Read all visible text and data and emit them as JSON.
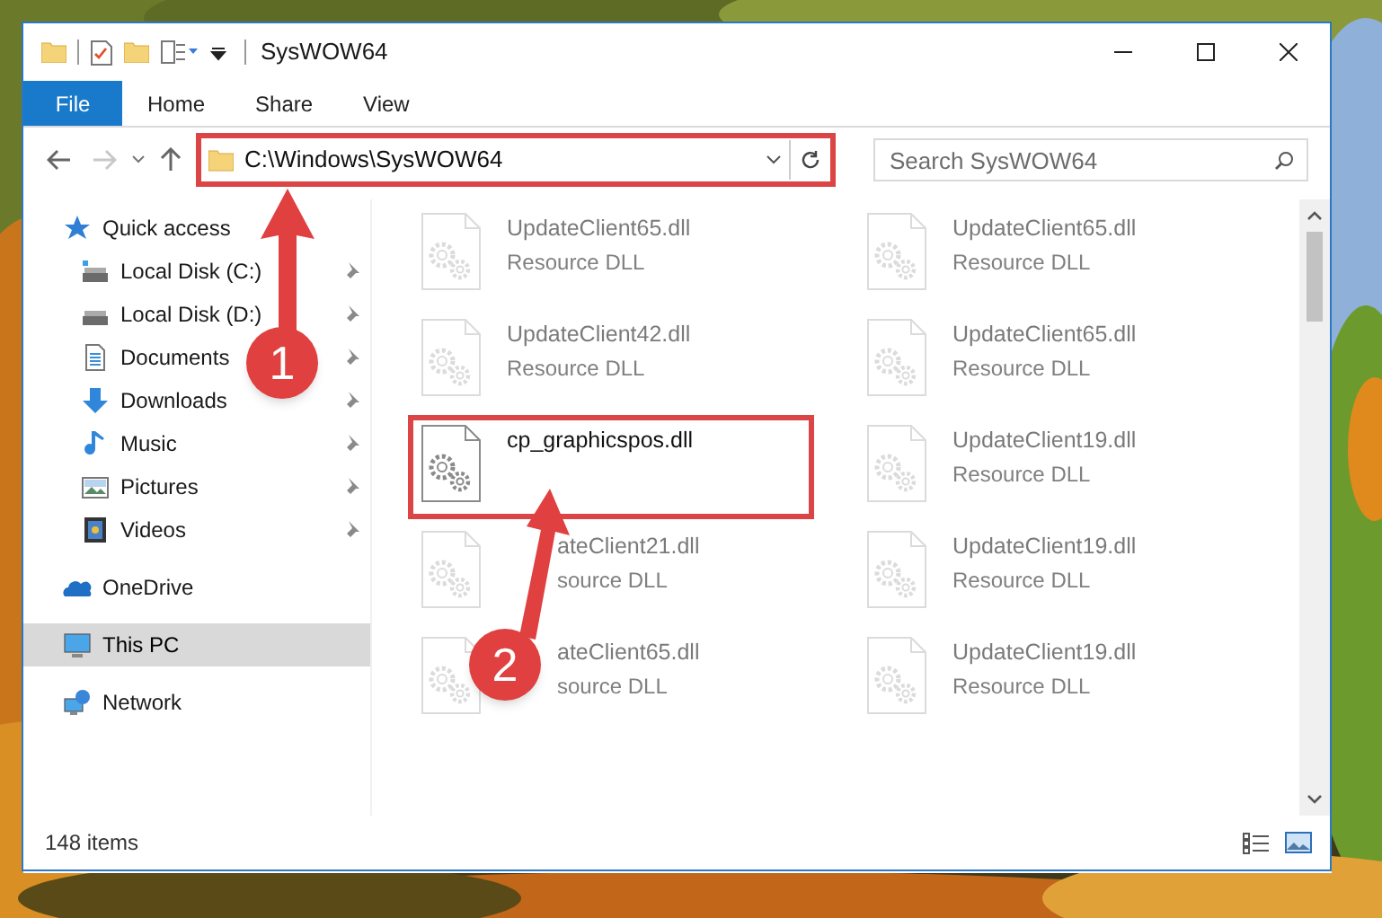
{
  "window": {
    "title": "SysWOW64"
  },
  "ribbon_tabs": [
    {
      "label": "File",
      "kind": "menu"
    },
    {
      "label": "Home",
      "kind": "tab"
    },
    {
      "label": "Share",
      "kind": "tab"
    },
    {
      "label": "View",
      "kind": "tab"
    }
  ],
  "address_bar": {
    "value": "C:\\Windows\\SysWOW64",
    "highlighted": true
  },
  "search": {
    "placeholder": "Search SysWOW64"
  },
  "navigation": [
    {
      "label": "Quick access",
      "kind": "star",
      "selected": false,
      "children": [
        {
          "label": "Local Disk (C:)",
          "kind": "system-drive",
          "pinned": true,
          "selected": false
        },
        {
          "label": "Local Disk (D:)",
          "kind": "drive",
          "pinned": true,
          "selected": false
        },
        {
          "label": "Documents",
          "kind": "document",
          "pinned": true,
          "selected": false
        },
        {
          "label": "Downloads",
          "kind": "download",
          "pinned": true,
          "selected": false
        },
        {
          "label": "Music",
          "kind": "music",
          "pinned": true,
          "selected": false
        },
        {
          "label": "Pictures",
          "kind": "pictures",
          "pinned": true,
          "selected": false
        },
        {
          "label": "Videos",
          "kind": "videos",
          "pinned": true,
          "selected": false
        }
      ]
    },
    {
      "label": "OneDrive",
      "kind": "cloud",
      "selected": false
    },
    {
      "label": "This PC",
      "kind": "computer",
      "selected": true
    },
    {
      "label": "Network",
      "kind": "network",
      "selected": false
    }
  ],
  "files": [
    {
      "name": "UpdateClient65.dll",
      "type": "Resource DLL",
      "blurred": true,
      "highlighted": false
    },
    {
      "name": "UpdateClient65.dll",
      "type": "Resource DLL",
      "blurred": true,
      "highlighted": false
    },
    {
      "name": "UpdateClient42.dll",
      "type": "Resource DLL",
      "blurred": true,
      "highlighted": false
    },
    {
      "name": "UpdateClient65.dll",
      "type": "Resource DLL",
      "blurred": true,
      "highlighted": false
    },
    {
      "name": "cp_graphicspos.dll",
      "blurred": false,
      "highlighted": true
    },
    {
      "name": "UpdateClient19.dll",
      "type": "Resource DLL",
      "blurred": true,
      "highlighted": false
    },
    {
      "name": "ateClient21.dll",
      "type": "source DLL",
      "blurred": true,
      "highlighted": false,
      "covered": true
    },
    {
      "name": "UpdateClient19.dll",
      "type": "Resource DLL",
      "blurred": true,
      "highlighted": false
    },
    {
      "name": "ateClient65.dll",
      "type": "source DLL",
      "blurred": true,
      "highlighted": false,
      "covered": true
    },
    {
      "name": "UpdateClient19.dll",
      "type": "Resource DLL",
      "blurred": true,
      "highlighted": false
    }
  ],
  "status_bar": {
    "item_count": "148 items"
  },
  "callouts": [
    {
      "number": "1"
    },
    {
      "number": "2"
    }
  ]
}
